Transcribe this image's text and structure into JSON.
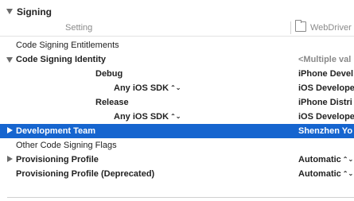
{
  "section": {
    "title": "Signing"
  },
  "header": {
    "setting_label": "Setting",
    "target_label": "WebDriver"
  },
  "rows": [
    {
      "name": "Code Signing Entitlements",
      "value": ""
    },
    {
      "name": "Code Signing Identity",
      "value": "<Multiple val"
    },
    {
      "name": "Debug",
      "value": "iPhone Devel"
    },
    {
      "name": "Any iOS SDK",
      "value": "iOS Develope"
    },
    {
      "name": "Release",
      "value": "iPhone Distri"
    },
    {
      "name": "Any iOS SDK",
      "value": "iOS Develope"
    },
    {
      "name": "Development Team",
      "value": "Shenzhen Yo"
    },
    {
      "name": "Other Code Signing Flags",
      "value": ""
    },
    {
      "name": "Provisioning Profile",
      "value": "Automatic"
    },
    {
      "name": "Provisioning Profile (Deprecated)",
      "value": "Automatic"
    }
  ],
  "stepper_glyph": "⌃⌄",
  "colors": {
    "selection": "#1665cf",
    "label": "#222222",
    "muted": "#8a8a8a"
  }
}
